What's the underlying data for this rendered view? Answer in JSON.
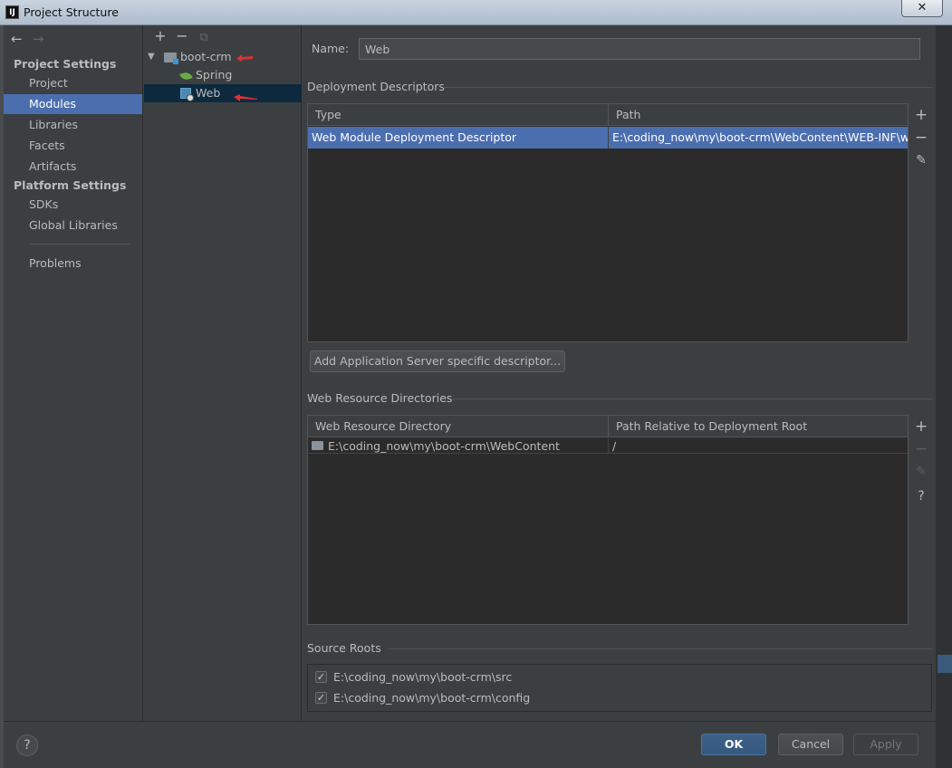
{
  "window": {
    "title": "Project Structure",
    "close": "✕",
    "app_icon": "IJ"
  },
  "nav": {
    "back": "←",
    "forward": "→",
    "project_settings": "Project Settings",
    "project_items": [
      "Project",
      "Modules",
      "Libraries",
      "Facets",
      "Artifacts"
    ],
    "platform_settings": "Platform Settings",
    "platform_items": [
      "SDKs",
      "Global Libraries"
    ],
    "problems": "Problems",
    "selected": "Modules"
  },
  "tree": {
    "toolbar": {
      "add": "+",
      "remove": "−",
      "copy": "⧉"
    },
    "root": "boot-crm",
    "children": [
      "Spring",
      "Web"
    ],
    "selected": "Web"
  },
  "detail": {
    "name_label": "Name:",
    "name_value": "Web",
    "deployment": {
      "title": "Deployment Descriptors",
      "columns": [
        "Type",
        "Path"
      ],
      "rows": [
        {
          "type": "Web Module Deployment Descriptor",
          "path": "E:\\coding_now\\my\\boot-crm\\WebContent\\WEB-INF\\web.xml"
        }
      ]
    },
    "add_server_descriptor": "Add Application Server specific descriptor...",
    "web_resources": {
      "title": "Web Resource Directories",
      "columns": [
        "Web Resource Directory",
        "Path Relative to Deployment Root"
      ],
      "rows": [
        {
          "dir": "E:\\coding_now\\my\\boot-crm\\WebContent",
          "rel": "/"
        }
      ]
    },
    "source_roots": {
      "title": "Source Roots",
      "items": [
        "E:\\coding_now\\my\\boot-crm\\src",
        "E:\\coding_now\\my\\boot-crm\\config"
      ]
    },
    "tools": {
      "add": "+",
      "remove": "−",
      "edit": "✎",
      "help": "?"
    }
  },
  "footer": {
    "help": "?",
    "ok": "OK",
    "cancel": "Cancel",
    "apply": "Apply"
  },
  "colors": {
    "background": "#3c3f41",
    "selection": "#4b6eaf",
    "primary_button": "#365880",
    "annotation_arrow": "#e03030"
  }
}
